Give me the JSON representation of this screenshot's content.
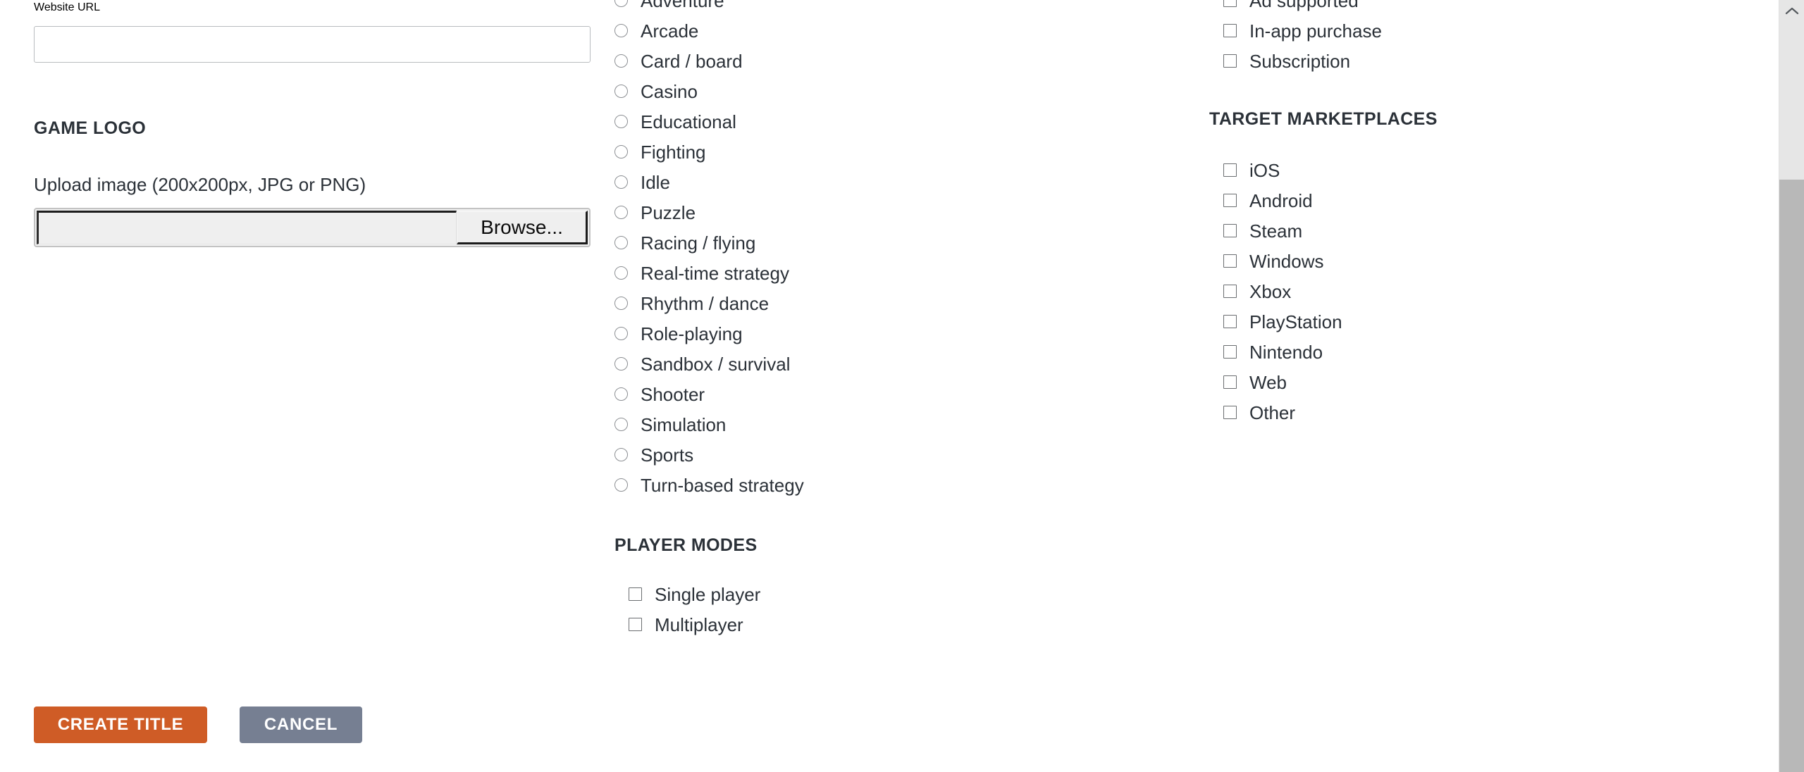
{
  "form": {
    "website_url": {
      "label": "Website URL",
      "value": "",
      "placeholder": ""
    },
    "game_logo": {
      "heading": "GAME LOGO",
      "upload_label": "Upload image (200x200px, JPG or PNG)",
      "file_value": "",
      "browse_label": "Browse..."
    },
    "genres": {
      "options": [
        "Adventure",
        "Arcade",
        "Card / board",
        "Casino",
        "Educational",
        "Fighting",
        "Idle",
        "Puzzle",
        "Racing / flying",
        "Real-time strategy",
        "Rhythm / dance",
        "Role-playing",
        "Sandbox / survival",
        "Shooter",
        "Simulation",
        "Sports",
        "Turn-based strategy"
      ]
    },
    "player_modes": {
      "heading": "PLAYER MODES",
      "options": [
        "Single player",
        "Multiplayer"
      ]
    },
    "monetization": {
      "options": [
        "Ad supported",
        "In-app purchase",
        "Subscription"
      ]
    },
    "target_marketplaces": {
      "heading": "TARGET MARKETPLACES",
      "options": [
        "iOS",
        "Android",
        "Steam",
        "Windows",
        "Xbox",
        "PlayStation",
        "Nintendo",
        "Web",
        "Other"
      ]
    }
  },
  "actions": {
    "primary_label": "CREATE TITLE",
    "secondary_label": "CANCEL"
  },
  "scrollbar": {
    "up_arrow_icon": "chevron-up-icon"
  },
  "colors": {
    "primary_button": "#cf5c26",
    "secondary_button": "#767f92",
    "text": "#2b3138",
    "input_border": "#b9bcbf",
    "scrollbar_track": "#e6e6e6",
    "scrollbar_thumb": "#b8b8b8"
  }
}
